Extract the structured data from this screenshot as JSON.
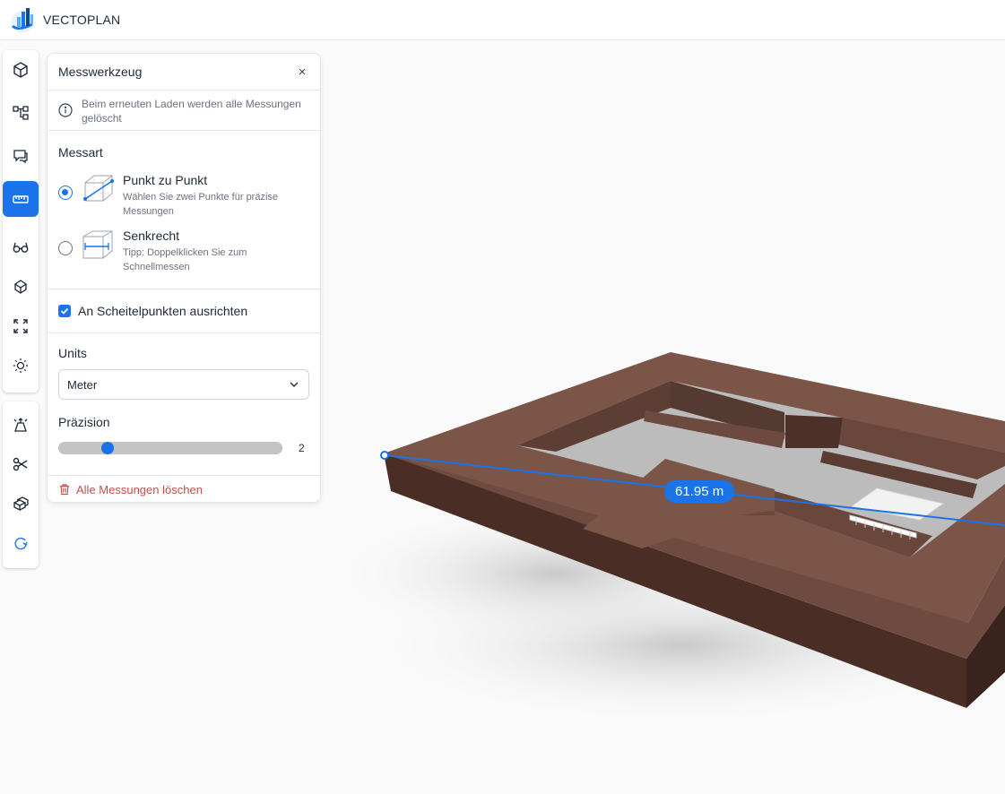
{
  "app": {
    "name": "VECTOPLAN",
    "logo_icon": "vectoplan-logo-icon"
  },
  "toolbar": {
    "primary": [
      {
        "name": "model-cube-icon",
        "active": false
      },
      {
        "name": "tree-structure-icon",
        "active": false
      },
      {
        "name": "comments-icon",
        "active": false
      },
      {
        "name": "ruler-measure-icon",
        "active": true
      },
      {
        "name": "glasses-icon",
        "active": false
      },
      {
        "name": "explode-icon",
        "active": false
      },
      {
        "name": "fit-view-icon",
        "active": false
      },
      {
        "name": "sun-icon",
        "active": false
      }
    ],
    "secondary": [
      {
        "name": "section-plane-icon",
        "active": false
      },
      {
        "name": "scissors-icon",
        "active": false
      },
      {
        "name": "layers-3d-icon",
        "active": false
      },
      {
        "name": "refresh-icon",
        "active": false
      }
    ]
  },
  "panel": {
    "title": "Messwerkzeug",
    "close_label": "×",
    "info_text": "Beim erneuten Laden werden alle Messungen gelöscht",
    "messart": {
      "label": "Messart",
      "options": [
        {
          "title": "Punkt zu Punkt",
          "desc": "Wählen Sie zwei Punkte für präzise Messungen",
          "selected": true
        },
        {
          "title": "Senkrecht",
          "desc": "Tipp: Doppelklicken Sie zum Schnellmessen",
          "selected": false
        }
      ]
    },
    "snap": {
      "label": "An Scheitelpunkten ausrichten",
      "checked": true
    },
    "units": {
      "label": "Units",
      "value": "Meter"
    },
    "precision": {
      "label": "Präzision",
      "value": "2",
      "fraction": 0.22
    },
    "clear_label": "Alle Messungen löschen"
  },
  "measurement": {
    "label": "61.95 m"
  },
  "colors": {
    "accent": "#1a73e8",
    "building": "#7a5548",
    "danger": "#c0504d"
  }
}
